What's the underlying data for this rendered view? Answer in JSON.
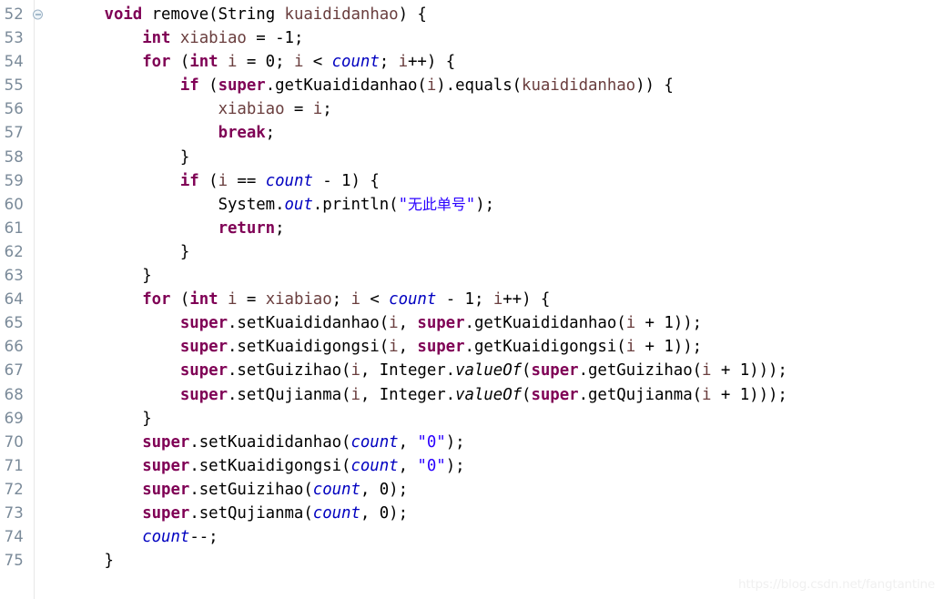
{
  "editor": {
    "language": "java",
    "first_line_number": 52,
    "last_line_number": 75,
    "background_color": "#ffffff",
    "gutter_color": "#7a8a99",
    "colors": {
      "keyword": "#7f0055",
      "string": "#2a00ff",
      "field": "#0000c0",
      "local_variable": "#6a3e3e",
      "plain": "#000000",
      "gutter_divider": "#e8e8e8",
      "fold_marker": "#5b7f9e",
      "watermark": "#f0f0f0"
    }
  },
  "watermark": {
    "text": "https://blog.csdn.net/fangtantine"
  },
  "lines": [
    {
      "number": "52",
      "fold": true,
      "tokens": [
        {
          "t": "      ",
          "c": "plain"
        },
        {
          "t": "void",
          "c": "kw"
        },
        {
          "t": " remove(",
          "c": "plain"
        },
        {
          "t": "String",
          "c": "plain"
        },
        {
          "t": " ",
          "c": "plain"
        },
        {
          "t": "kuaididanhao",
          "c": "local"
        },
        {
          "t": ") {",
          "c": "plain"
        }
      ]
    },
    {
      "number": "53",
      "fold": false,
      "tokens": [
        {
          "t": "          ",
          "c": "plain"
        },
        {
          "t": "int",
          "c": "kw"
        },
        {
          "t": " ",
          "c": "plain"
        },
        {
          "t": "xiabiao",
          "c": "local"
        },
        {
          "t": " = -1;",
          "c": "plain"
        }
      ]
    },
    {
      "number": "54",
      "fold": false,
      "tokens": [
        {
          "t": "          ",
          "c": "plain"
        },
        {
          "t": "for",
          "c": "kw"
        },
        {
          "t": " (",
          "c": "plain"
        },
        {
          "t": "int",
          "c": "kw"
        },
        {
          "t": " ",
          "c": "plain"
        },
        {
          "t": "i",
          "c": "local"
        },
        {
          "t": " = 0; ",
          "c": "plain"
        },
        {
          "t": "i",
          "c": "local"
        },
        {
          "t": " < ",
          "c": "plain"
        },
        {
          "t": "count",
          "c": "field"
        },
        {
          "t": "; ",
          "c": "plain"
        },
        {
          "t": "i",
          "c": "local"
        },
        {
          "t": "++) {",
          "c": "plain"
        }
      ]
    },
    {
      "number": "55",
      "fold": false,
      "tokens": [
        {
          "t": "              ",
          "c": "plain"
        },
        {
          "t": "if",
          "c": "kw"
        },
        {
          "t": " (",
          "c": "plain"
        },
        {
          "t": "super",
          "c": "kw"
        },
        {
          "t": ".getKuaididanhao(",
          "c": "plain"
        },
        {
          "t": "i",
          "c": "local"
        },
        {
          "t": ").equals(",
          "c": "plain"
        },
        {
          "t": "kuaididanhao",
          "c": "local"
        },
        {
          "t": ")) {",
          "c": "plain"
        }
      ]
    },
    {
      "number": "56",
      "fold": false,
      "tokens": [
        {
          "t": "                  ",
          "c": "plain"
        },
        {
          "t": "xiabiao",
          "c": "local"
        },
        {
          "t": " = ",
          "c": "plain"
        },
        {
          "t": "i",
          "c": "local"
        },
        {
          "t": ";",
          "c": "plain"
        }
      ]
    },
    {
      "number": "57",
      "fold": false,
      "tokens": [
        {
          "t": "                  ",
          "c": "plain"
        },
        {
          "t": "break",
          "c": "kw"
        },
        {
          "t": ";",
          "c": "plain"
        }
      ]
    },
    {
      "number": "58",
      "fold": false,
      "tokens": [
        {
          "t": "              }",
          "c": "plain"
        }
      ]
    },
    {
      "number": "59",
      "fold": false,
      "tokens": [
        {
          "t": "              ",
          "c": "plain"
        },
        {
          "t": "if",
          "c": "kw"
        },
        {
          "t": " (",
          "c": "plain"
        },
        {
          "t": "i",
          "c": "local"
        },
        {
          "t": " == ",
          "c": "plain"
        },
        {
          "t": "count",
          "c": "field"
        },
        {
          "t": " - 1) {",
          "c": "plain"
        }
      ]
    },
    {
      "number": "60",
      "fold": false,
      "tokens": [
        {
          "t": "                  ",
          "c": "plain"
        },
        {
          "t": "System.",
          "c": "plain"
        },
        {
          "t": "out",
          "c": "field"
        },
        {
          "t": ".println(",
          "c": "plain"
        },
        {
          "t": "\"",
          "c": "string"
        },
        {
          "t": "无此单号",
          "c": "cjk"
        },
        {
          "t": "\"",
          "c": "string"
        },
        {
          "t": ");",
          "c": "plain"
        }
      ]
    },
    {
      "number": "61",
      "fold": false,
      "tokens": [
        {
          "t": "                  ",
          "c": "plain"
        },
        {
          "t": "return",
          "c": "kw"
        },
        {
          "t": ";",
          "c": "plain"
        }
      ]
    },
    {
      "number": "62",
      "fold": false,
      "tokens": [
        {
          "t": "              }",
          "c": "plain"
        }
      ]
    },
    {
      "number": "63",
      "fold": false,
      "tokens": [
        {
          "t": "          }",
          "c": "plain"
        }
      ]
    },
    {
      "number": "64",
      "fold": false,
      "tokens": [
        {
          "t": "          ",
          "c": "plain"
        },
        {
          "t": "for",
          "c": "kw"
        },
        {
          "t": " (",
          "c": "plain"
        },
        {
          "t": "int",
          "c": "kw"
        },
        {
          "t": " ",
          "c": "plain"
        },
        {
          "t": "i",
          "c": "local"
        },
        {
          "t": " = ",
          "c": "plain"
        },
        {
          "t": "xiabiao",
          "c": "local"
        },
        {
          "t": "; ",
          "c": "plain"
        },
        {
          "t": "i",
          "c": "local"
        },
        {
          "t": " < ",
          "c": "plain"
        },
        {
          "t": "count",
          "c": "field"
        },
        {
          "t": " - 1; ",
          "c": "plain"
        },
        {
          "t": "i",
          "c": "local"
        },
        {
          "t": "++) {",
          "c": "plain"
        }
      ]
    },
    {
      "number": "65",
      "fold": false,
      "tokens": [
        {
          "t": "              ",
          "c": "plain"
        },
        {
          "t": "super",
          "c": "kw"
        },
        {
          "t": ".setKuaididanhao(",
          "c": "plain"
        },
        {
          "t": "i",
          "c": "local"
        },
        {
          "t": ", ",
          "c": "plain"
        },
        {
          "t": "super",
          "c": "kw"
        },
        {
          "t": ".getKuaididanhao(",
          "c": "plain"
        },
        {
          "t": "i",
          "c": "local"
        },
        {
          "t": " + 1));",
          "c": "plain"
        }
      ]
    },
    {
      "number": "66",
      "fold": false,
      "tokens": [
        {
          "t": "              ",
          "c": "plain"
        },
        {
          "t": "super",
          "c": "kw"
        },
        {
          "t": ".setKuaidigongsi(",
          "c": "plain"
        },
        {
          "t": "i",
          "c": "local"
        },
        {
          "t": ", ",
          "c": "plain"
        },
        {
          "t": "super",
          "c": "kw"
        },
        {
          "t": ".getKuaidigongsi(",
          "c": "plain"
        },
        {
          "t": "i",
          "c": "local"
        },
        {
          "t": " + 1));",
          "c": "plain"
        }
      ]
    },
    {
      "number": "67",
      "fold": false,
      "tokens": [
        {
          "t": "              ",
          "c": "plain"
        },
        {
          "t": "super",
          "c": "kw"
        },
        {
          "t": ".setGuizihao(",
          "c": "plain"
        },
        {
          "t": "i",
          "c": "local"
        },
        {
          "t": ", Integer.",
          "c": "plain"
        },
        {
          "t": "valueOf",
          "c": "static"
        },
        {
          "t": "(",
          "c": "plain"
        },
        {
          "t": "super",
          "c": "kw"
        },
        {
          "t": ".getGuizihao(",
          "c": "plain"
        },
        {
          "t": "i",
          "c": "local"
        },
        {
          "t": " + 1)));",
          "c": "plain"
        }
      ]
    },
    {
      "number": "68",
      "fold": false,
      "tokens": [
        {
          "t": "              ",
          "c": "plain"
        },
        {
          "t": "super",
          "c": "kw"
        },
        {
          "t": ".setQujianma(",
          "c": "plain"
        },
        {
          "t": "i",
          "c": "local"
        },
        {
          "t": ", Integer.",
          "c": "plain"
        },
        {
          "t": "valueOf",
          "c": "static"
        },
        {
          "t": "(",
          "c": "plain"
        },
        {
          "t": "super",
          "c": "kw"
        },
        {
          "t": ".getQujianma(",
          "c": "plain"
        },
        {
          "t": "i",
          "c": "local"
        },
        {
          "t": " + 1)));",
          "c": "plain"
        }
      ]
    },
    {
      "number": "69",
      "fold": false,
      "tokens": [
        {
          "t": "          }",
          "c": "plain"
        }
      ]
    },
    {
      "number": "70",
      "fold": false,
      "tokens": [
        {
          "t": "          ",
          "c": "plain"
        },
        {
          "t": "super",
          "c": "kw"
        },
        {
          "t": ".setKuaididanhao(",
          "c": "plain"
        },
        {
          "t": "count",
          "c": "field"
        },
        {
          "t": ", ",
          "c": "plain"
        },
        {
          "t": "\"0\"",
          "c": "string"
        },
        {
          "t": ");",
          "c": "plain"
        }
      ]
    },
    {
      "number": "71",
      "fold": false,
      "tokens": [
        {
          "t": "          ",
          "c": "plain"
        },
        {
          "t": "super",
          "c": "kw"
        },
        {
          "t": ".setKuaidigongsi(",
          "c": "plain"
        },
        {
          "t": "count",
          "c": "field"
        },
        {
          "t": ", ",
          "c": "plain"
        },
        {
          "t": "\"0\"",
          "c": "string"
        },
        {
          "t": ");",
          "c": "plain"
        }
      ]
    },
    {
      "number": "72",
      "fold": false,
      "tokens": [
        {
          "t": "          ",
          "c": "plain"
        },
        {
          "t": "super",
          "c": "kw"
        },
        {
          "t": ".setGuizihao(",
          "c": "plain"
        },
        {
          "t": "count",
          "c": "field"
        },
        {
          "t": ", 0);",
          "c": "plain"
        }
      ]
    },
    {
      "number": "73",
      "fold": false,
      "tokens": [
        {
          "t": "          ",
          "c": "plain"
        },
        {
          "t": "super",
          "c": "kw"
        },
        {
          "t": ".setQujianma(",
          "c": "plain"
        },
        {
          "t": "count",
          "c": "field"
        },
        {
          "t": ", 0);",
          "c": "plain"
        }
      ]
    },
    {
      "number": "74",
      "fold": false,
      "tokens": [
        {
          "t": "          ",
          "c": "plain"
        },
        {
          "t": "count",
          "c": "field"
        },
        {
          "t": "--;",
          "c": "plain"
        }
      ]
    },
    {
      "number": "75",
      "fold": false,
      "tokens": [
        {
          "t": "      }",
          "c": "plain"
        }
      ]
    }
  ]
}
